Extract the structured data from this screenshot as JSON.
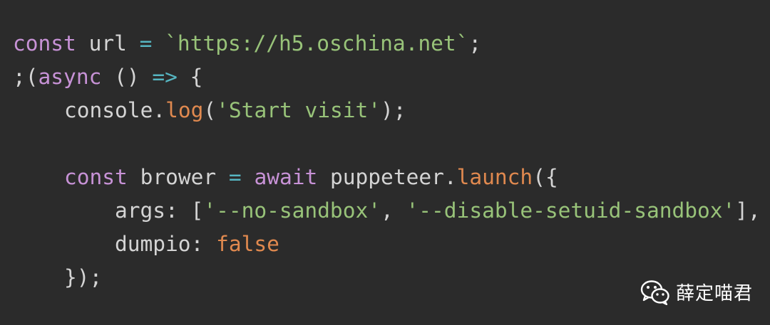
{
  "editor": {
    "lines": [
      {
        "tokens": [
          {
            "t": "const",
            "c": "kw"
          },
          {
            "t": " url ",
            "c": "ident"
          },
          {
            "t": "=",
            "c": "op"
          },
          {
            "t": " ",
            "c": "ident"
          },
          {
            "t": "`https://h5.oschina.net`",
            "c": "str"
          },
          {
            "t": ";",
            "c": "punc"
          }
        ]
      },
      {
        "tokens": [
          {
            "t": ";(",
            "c": "punc"
          },
          {
            "t": "async",
            "c": "kw"
          },
          {
            "t": " () ",
            "c": "punc"
          },
          {
            "t": "=>",
            "c": "op"
          },
          {
            "t": " {",
            "c": "punc"
          }
        ]
      },
      {
        "tokens": [
          {
            "t": "console.",
            "c": "ident"
          },
          {
            "t": "log",
            "c": "fn"
          },
          {
            "t": "(",
            "c": "punc"
          },
          {
            "t": "'Start visit'",
            "c": "str"
          },
          {
            "t": ");",
            "c": "punc"
          }
        ]
      },
      {
        "tokens": []
      },
      {
        "tokens": [
          {
            "t": "const",
            "c": "kw"
          },
          {
            "t": " brower ",
            "c": "ident"
          },
          {
            "t": "=",
            "c": "op"
          },
          {
            "t": " ",
            "c": "ident"
          },
          {
            "t": "await",
            "c": "kw"
          },
          {
            "t": " puppeteer.",
            "c": "ident"
          },
          {
            "t": "launch",
            "c": "fn"
          },
          {
            "t": "({",
            "c": "punc"
          }
        ]
      },
      {
        "tokens": [
          {
            "t": "args: [",
            "c": "ident"
          },
          {
            "t": "'--no-sandbox'",
            "c": "str"
          },
          {
            "t": ", ",
            "c": "punc"
          },
          {
            "t": "'--disable-setuid-sandbox'",
            "c": "str"
          },
          {
            "t": "],",
            "c": "punc"
          }
        ]
      },
      {
        "tokens": [
          {
            "t": "dumpio: ",
            "c": "ident"
          },
          {
            "t": "false",
            "c": "lit"
          }
        ]
      },
      {
        "tokens": [
          {
            "t": "});",
            "c": "punc"
          }
        ]
      }
    ]
  },
  "watermark": {
    "text": "薛定喵君",
    "icon": "wechat-icon"
  },
  "colors": {
    "background": "#2b2b2b",
    "keyword": "#c792d6",
    "string": "#98c379",
    "function": "#e0894f",
    "operator": "#56b6c2",
    "text": "#d4d4d4"
  }
}
